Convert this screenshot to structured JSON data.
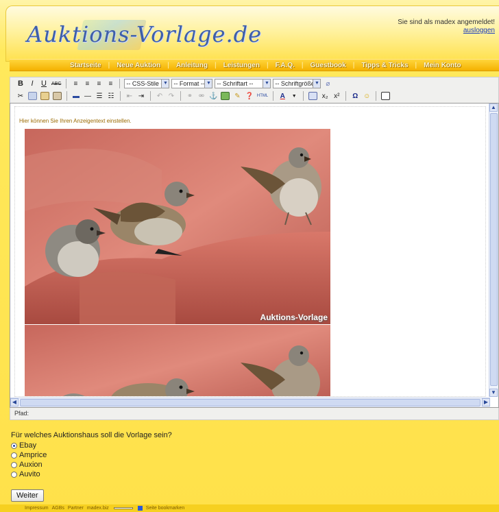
{
  "header": {
    "logo_text": "Auktions-Vorlage.de",
    "login_status": "Sie sind als madex angemeldet!",
    "logout_label": "ausloggen"
  },
  "nav": {
    "items": [
      "Startseite",
      "Neue Auktion",
      "Anleitung",
      "Leistungen",
      "F.A.Q.",
      "Guestbook",
      "Tipps & Tricks",
      "Mein Konto"
    ]
  },
  "toolbar": {
    "bold": "B",
    "italic": "I",
    "underline": "U",
    "strike": "ABC",
    "styles_select": "-- CSS-Stile --",
    "format_select": "-- Format --",
    "font_select": "-- Schriftart --",
    "size_select": "-- Schriftgröße --",
    "html_label": "HTML",
    "omega": "Ω",
    "sub": "x₂",
    "sup": "x²",
    "dropdown_arrow": "▼"
  },
  "editor": {
    "hint": "Hier können Sie Ihren Anzeigentext einstellen.",
    "watermark": "Auktions-Vorlage",
    "path_label": "Pfad:"
  },
  "form": {
    "question": "Für welches Auktionshaus soll die Vorlage sein?",
    "options": [
      "Ebay",
      "Amprice",
      "Auxion",
      "Auvito"
    ],
    "selected": "Ebay",
    "submit_label": "Weiter"
  },
  "footer": {
    "links": [
      "Impressum",
      "AGBs",
      "Partner",
      "madex.biz"
    ],
    "bookmark_label": "Seite bookmarken"
  },
  "colors": {
    "accent": "#ffe14a",
    "nav": "#f4b100",
    "logo": "#3e5fa8",
    "link": "#1a3cbb"
  }
}
